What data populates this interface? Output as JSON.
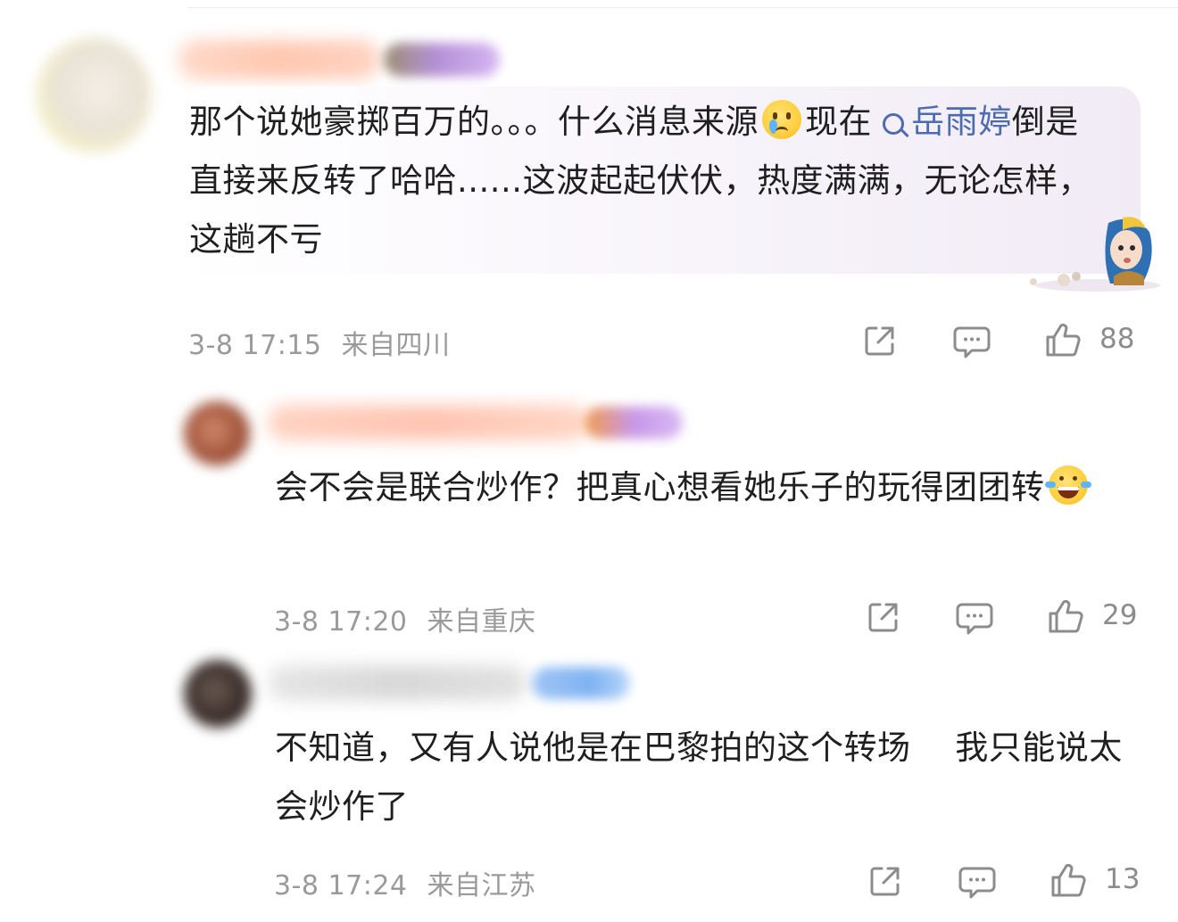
{
  "comments": [
    {
      "text_before": "那个说她豪掷百万的。。。什么消息来源",
      "text_mid": "现在",
      "link": "岳雨婷",
      "text_after": "倒是直接来反转了哈哈......这波起起伏伏，热度满满，无论怎样，这趟不亏",
      "emoji": "crying-face",
      "timestamp": "3-8 17:15",
      "location": "来自四川",
      "likes": "88"
    },
    {
      "text_before": "会不会是联合炒作？把真心想看她乐子的玩得团团转",
      "emoji": "tears-of-joy-face",
      "timestamp": "3-8 17:20",
      "location": "来自重庆",
      "likes": "29"
    },
    {
      "text_before": "不知道，又有人说他是在巴黎拍的这个转场　 我只能说太会炒作了",
      "timestamp": "3-8 17:24",
      "location": "来自江苏",
      "likes": "13"
    }
  ],
  "colors": {
    "link": "#4d6cb0",
    "meta_text": "#9a9a9a",
    "bubble_tint": "#f1ebf5"
  },
  "icons": [
    "share-icon",
    "comment-icon",
    "like-icon"
  ]
}
